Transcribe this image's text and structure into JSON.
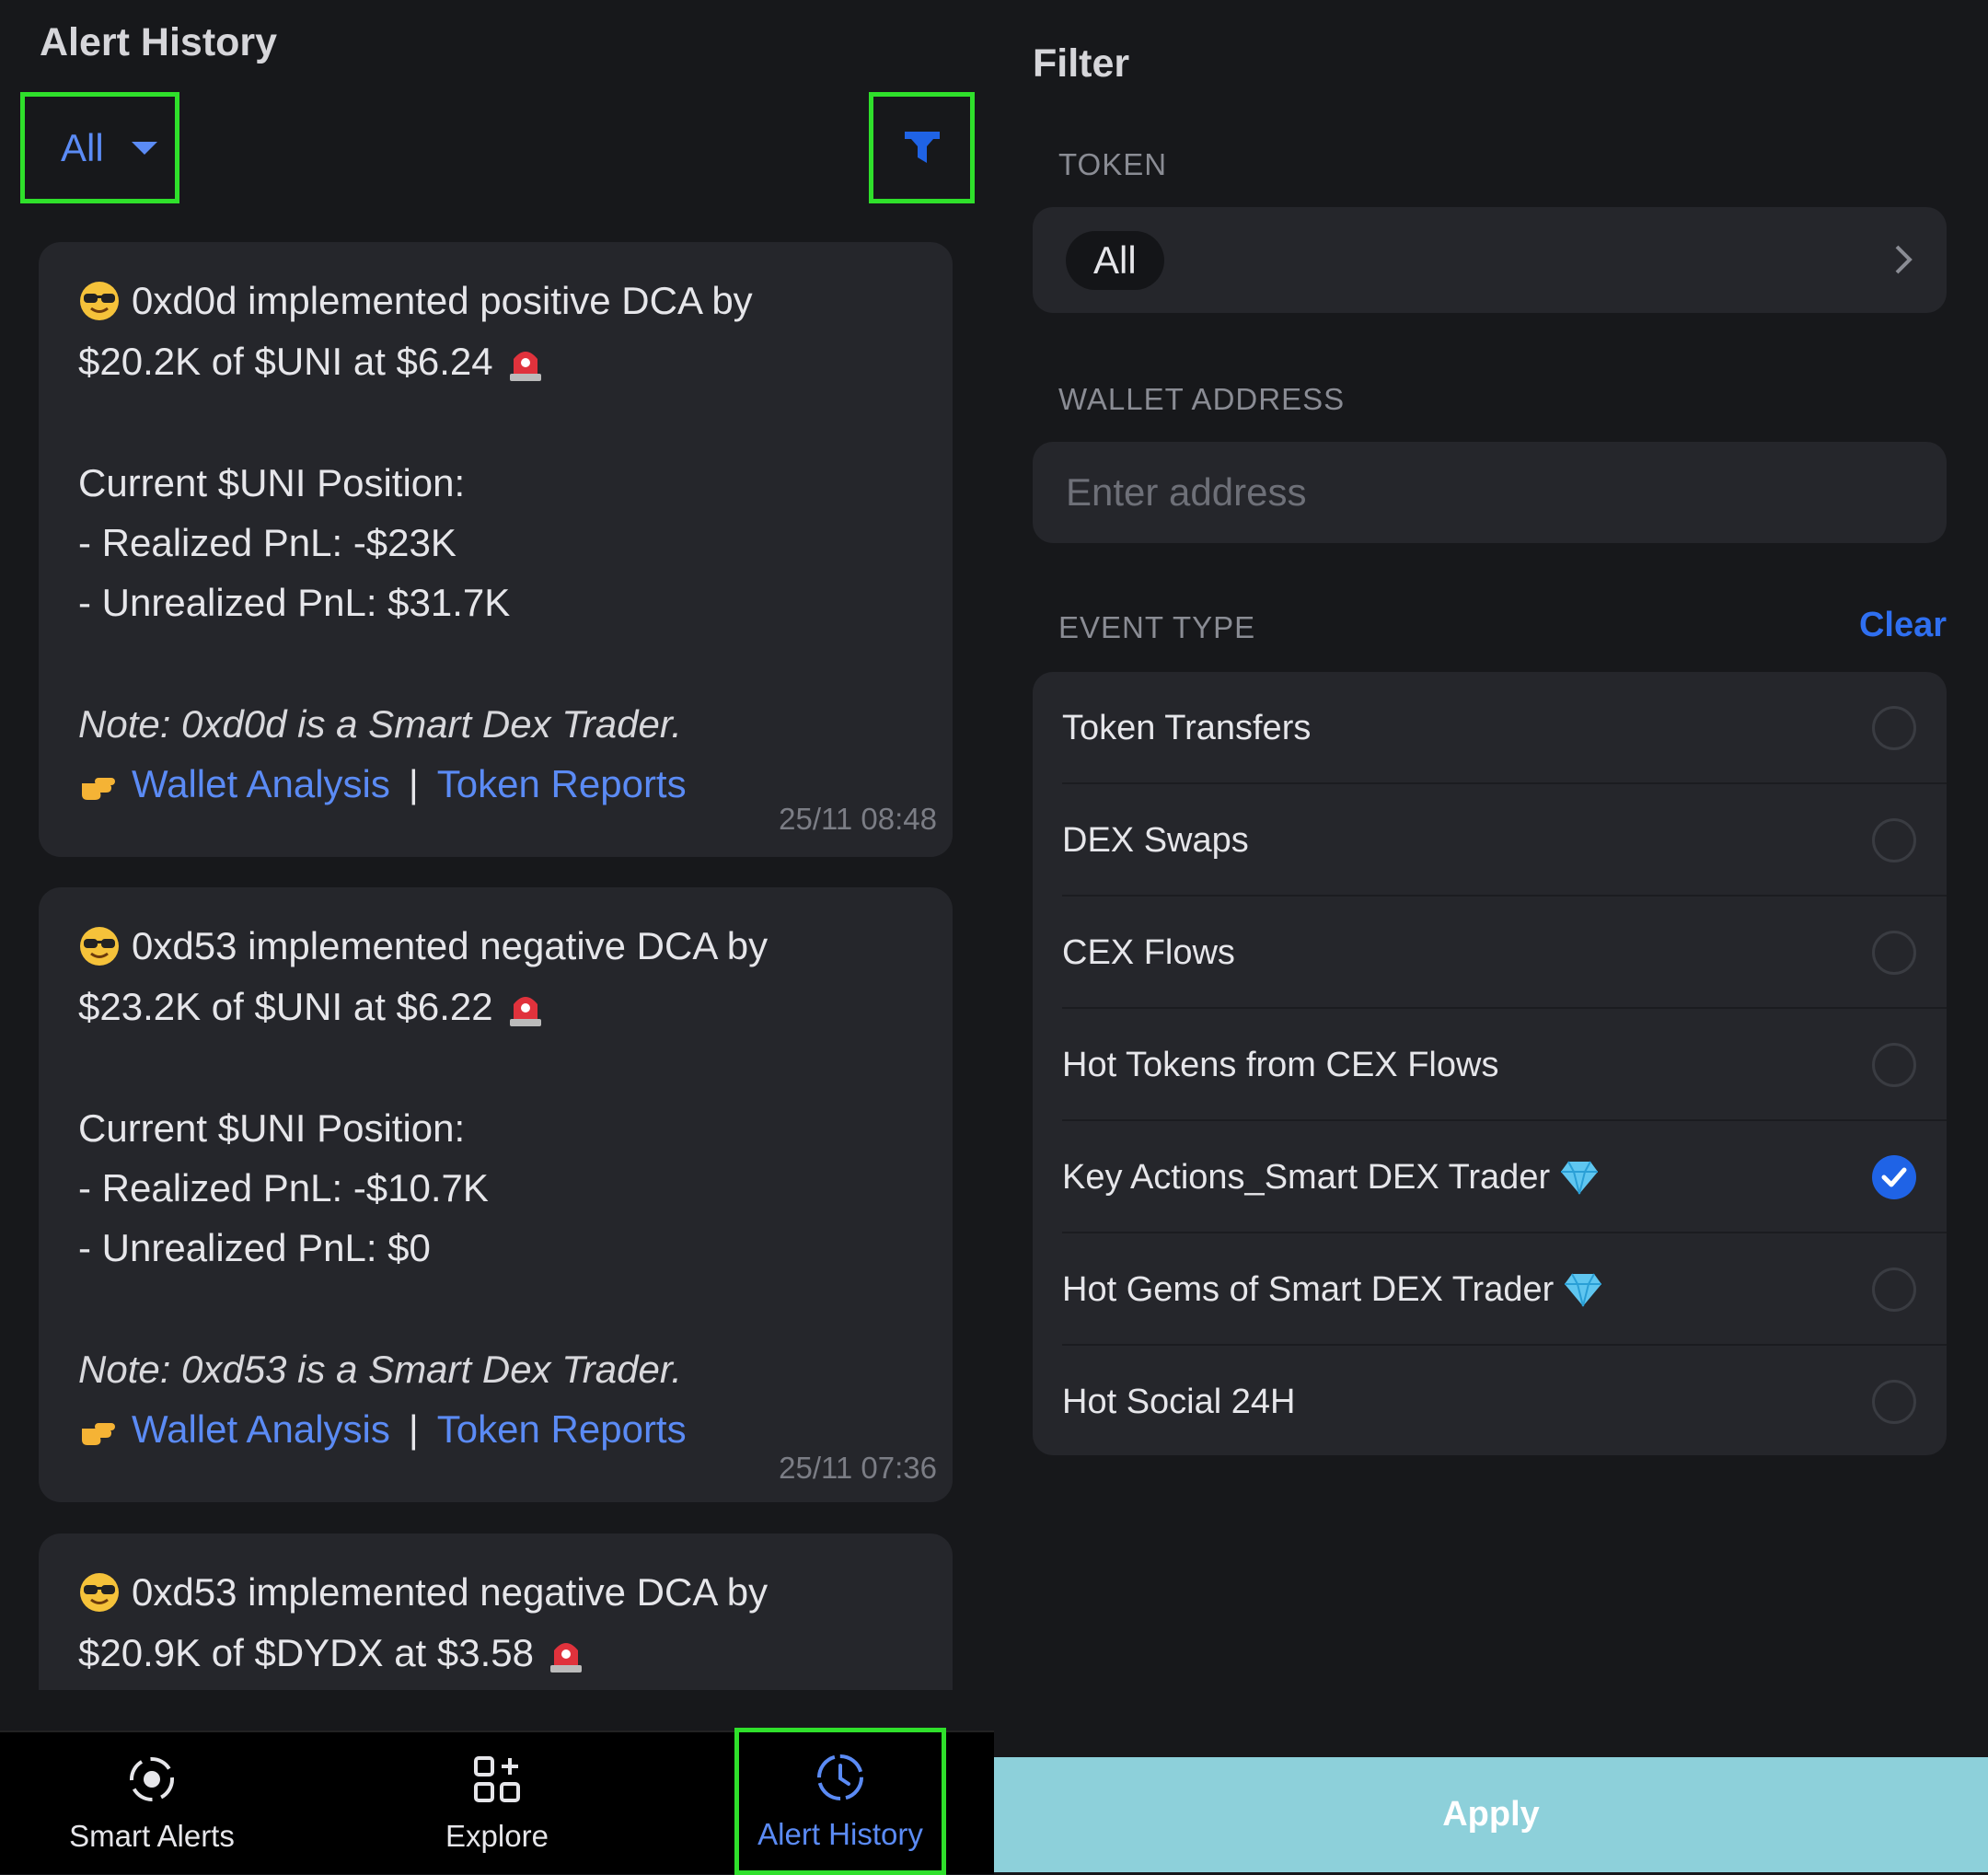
{
  "left": {
    "title": "Alert History",
    "dropdown_label": "All",
    "cards": [
      {
        "line1": "0xd0d implemented positive DCA by",
        "line2": "$20.2K of $UNI at $6.24",
        "position_header": "Current $UNI Position:",
        "realized": "- Realized PnL: -$23K",
        "unrealized": "- Unrealized PnL: $31.7K",
        "note": "Note: 0xd0d is a Smart Dex Trader.",
        "link1": "Wallet Analysis",
        "link2": "Token Reports",
        "separator": "|",
        "timestamp": "25/11 08:48"
      },
      {
        "line1": "0xd53 implemented negative DCA by",
        "line2": "$23.2K of $UNI at $6.22",
        "position_header": "Current $UNI Position:",
        "realized": "- Realized PnL: -$10.7K",
        "unrealized": "- Unrealized PnL: $0",
        "note": "Note: 0xd53 is a Smart Dex Trader.",
        "link1": "Wallet Analysis",
        "link2": "Token Reports",
        "separator": "|",
        "timestamp": "25/11 07:36"
      },
      {
        "line1": "0xd53 implemented negative DCA by",
        "line2": "$20.9K of $DYDX at $3.58"
      }
    ],
    "nav": [
      {
        "label": "Smart Alerts",
        "icon": "smart-alerts-icon"
      },
      {
        "label": "Explore",
        "icon": "explore-grid-icon"
      },
      {
        "label": "Alert History",
        "icon": "history-clock-icon",
        "active": true
      }
    ]
  },
  "right": {
    "title": "Filter",
    "token_label": "TOKEN",
    "token_value": "All",
    "wallet_label": "WALLET ADDRESS",
    "wallet_placeholder": "Enter address",
    "event_label": "EVENT TYPE",
    "clear_label": "Clear",
    "events": [
      {
        "label": "Token Transfers",
        "checked": false
      },
      {
        "label": "DEX Swaps",
        "checked": false
      },
      {
        "label": "CEX Flows",
        "checked": false
      },
      {
        "label": "Hot Tokens from CEX Flows",
        "checked": false
      },
      {
        "label": "Key Actions_Smart DEX Trader",
        "checked": true,
        "gem": true
      },
      {
        "label": "Hot Gems of Smart DEX Trader",
        "checked": false,
        "gem": true
      },
      {
        "label": "Hot Social 24H",
        "checked": false
      }
    ],
    "apply_label": "Apply"
  },
  "colors": {
    "accent": "#5b8bf5",
    "highlight": "#2fe02b",
    "apply_bg": "#8dd0da",
    "checked": "#1f63e6"
  }
}
